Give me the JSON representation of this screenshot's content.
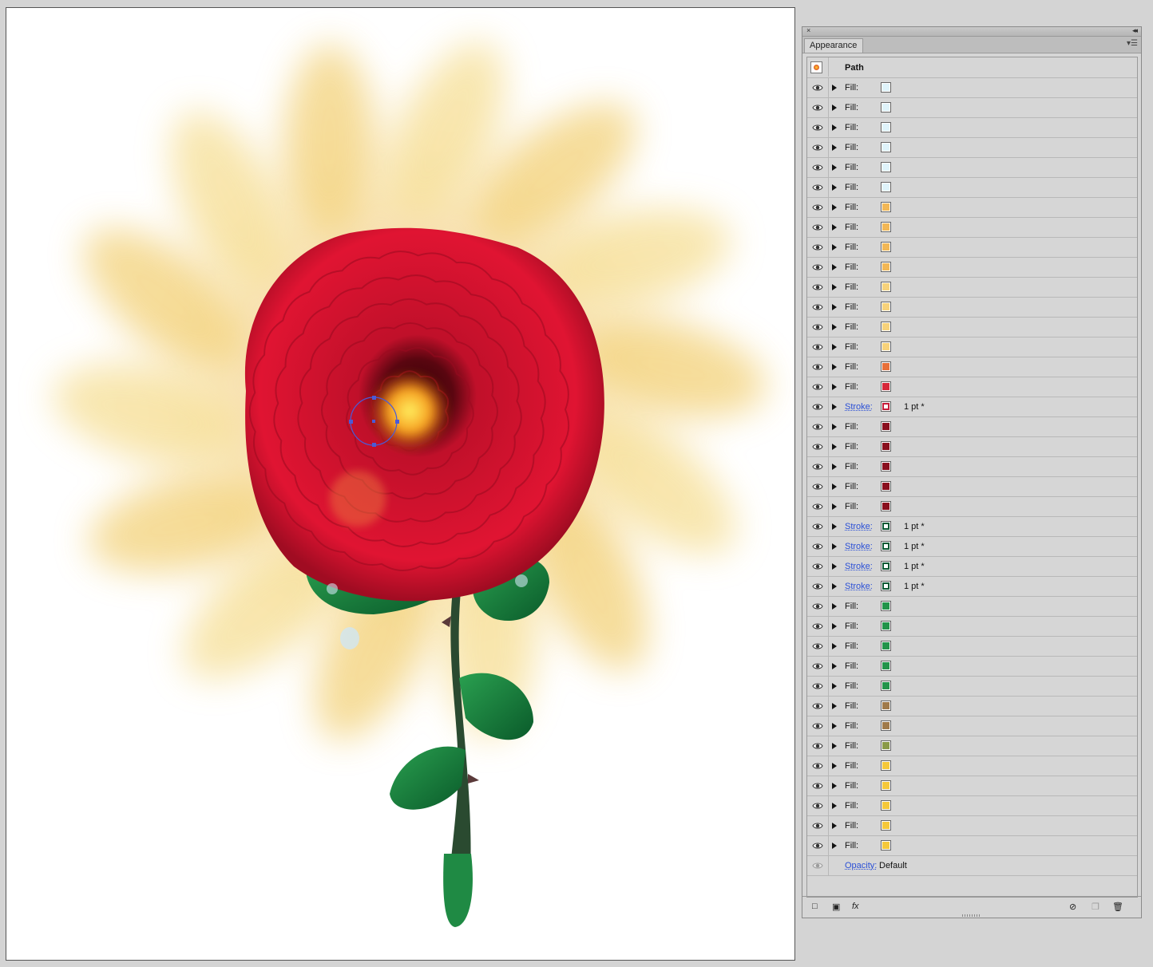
{
  "panel": {
    "title": "Appearance",
    "close_glyph": "×",
    "collapse_glyph": "◂◂",
    "menu_glyph": "▾☰",
    "object_label": "Path"
  },
  "attributes": [
    {
      "label": "Fill:",
      "color": "#dff3fa",
      "kind": "fill"
    },
    {
      "label": "Fill:",
      "color": "#dff3fa",
      "kind": "fill"
    },
    {
      "label": "Fill:",
      "color": "#dff3fa",
      "kind": "fill"
    },
    {
      "label": "Fill:",
      "color": "#dff3fa",
      "kind": "fill"
    },
    {
      "label": "Fill:",
      "color": "#dff3fa",
      "kind": "fill"
    },
    {
      "label": "Fill:",
      "color": "#dff3fa",
      "kind": "fill"
    },
    {
      "label": "Fill:",
      "color": "#f2b755",
      "kind": "fill"
    },
    {
      "label": "Fill:",
      "color": "#f2b755",
      "kind": "fill"
    },
    {
      "label": "Fill:",
      "color": "#f2b755",
      "kind": "fill"
    },
    {
      "label": "Fill:",
      "color": "#f2b755",
      "kind": "fill"
    },
    {
      "label": "Fill:",
      "color": "#f7d27a",
      "kind": "fill"
    },
    {
      "label": "Fill:",
      "color": "#f7d27a",
      "kind": "fill"
    },
    {
      "label": "Fill:",
      "color": "#f7d27a",
      "kind": "fill"
    },
    {
      "label": "Fill:",
      "color": "#f7d27a",
      "kind": "fill"
    },
    {
      "label": "Fill:",
      "color": "#e8703a",
      "kind": "fill"
    },
    {
      "label": "Fill:",
      "color": "#d6283a",
      "kind": "fill"
    },
    {
      "label": "Stroke:",
      "color": "#c41e3a",
      "kind": "stroke",
      "value": "1 pt *"
    },
    {
      "label": "Fill:",
      "color": "#8a0f1e",
      "kind": "fill"
    },
    {
      "label": "Fill:",
      "color": "#8a0f1e",
      "kind": "fill"
    },
    {
      "label": "Fill:",
      "color": "#8a0f1e",
      "kind": "fill"
    },
    {
      "label": "Fill:",
      "color": "#8a0f1e",
      "kind": "fill"
    },
    {
      "label": "Fill:",
      "color": "#8a0f1e",
      "kind": "fill"
    },
    {
      "label": "Stroke:",
      "color": "#0c5a34",
      "kind": "stroke",
      "value": "1 pt *"
    },
    {
      "label": "Stroke:",
      "color": "#0c5a34",
      "kind": "stroke",
      "value": "1 pt *"
    },
    {
      "label": "Stroke:",
      "color": "#0c5a34",
      "kind": "stroke",
      "value": "1 pt *"
    },
    {
      "label": "Stroke:",
      "color": "#0c5a34",
      "kind": "stroke",
      "value": "1 pt *"
    },
    {
      "label": "Fill:",
      "color": "#22944a",
      "kind": "fill"
    },
    {
      "label": "Fill:",
      "color": "#22944a",
      "kind": "fill"
    },
    {
      "label": "Fill:",
      "color": "#22944a",
      "kind": "fill"
    },
    {
      "label": "Fill:",
      "color": "#22944a",
      "kind": "fill"
    },
    {
      "label": "Fill:",
      "color": "#22944a",
      "kind": "fill"
    },
    {
      "label": "Fill:",
      "color": "#a07a4a",
      "kind": "fill"
    },
    {
      "label": "Fill:",
      "color": "#a07a4a",
      "kind": "fill"
    },
    {
      "label": "Fill:",
      "color": "#8a9a48",
      "kind": "fill"
    },
    {
      "label": "Fill:",
      "color": "#f5c83a",
      "kind": "fill"
    },
    {
      "label": "Fill:",
      "color": "#f5c83a",
      "kind": "fill"
    },
    {
      "label": "Fill:",
      "color": "#f5c83a",
      "kind": "fill"
    },
    {
      "label": "Fill:",
      "color": "#f5c83a",
      "kind": "fill"
    },
    {
      "label": "Fill:",
      "color": "#f5c83a",
      "kind": "fill"
    }
  ],
  "opacity": {
    "label": "Opacity:",
    "value": "Default"
  },
  "footer": {
    "new_stroke": "□",
    "new_fill": "▣",
    "fx": "fx",
    "clear": "⊘",
    "duplicate": "❐",
    "delete": "🗑"
  }
}
